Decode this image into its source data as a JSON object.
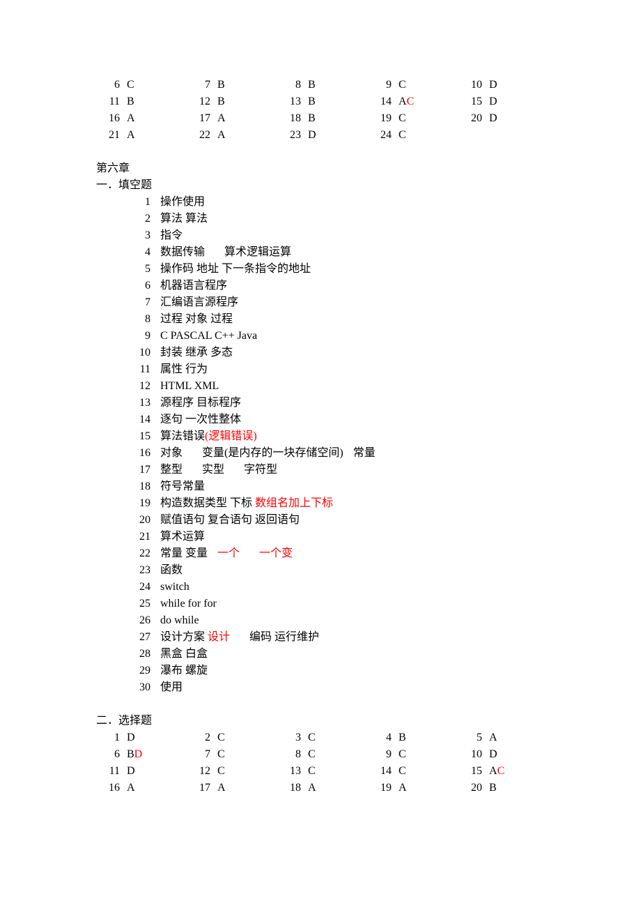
{
  "topMC": [
    [
      {
        "n": "6",
        "a": "C"
      },
      {
        "n": "7",
        "a": "B"
      },
      {
        "n": "8",
        "a": "B"
      },
      {
        "n": "9",
        "a": "C"
      },
      {
        "n": "10",
        "a": "D"
      }
    ],
    [
      {
        "n": "11",
        "a": "B"
      },
      {
        "n": "12",
        "a": "B"
      },
      {
        "n": "13",
        "a": "B"
      },
      {
        "n": "14",
        "a": "A",
        "red": "C"
      },
      {
        "n": "15",
        "a": "D"
      }
    ],
    [
      {
        "n": "16",
        "a": "A"
      },
      {
        "n": "17",
        "a": "A"
      },
      {
        "n": "18",
        "a": "B"
      },
      {
        "n": "19",
        "a": "C"
      },
      {
        "n": "20",
        "a": "D"
      }
    ],
    [
      {
        "n": "21",
        "a": "A"
      },
      {
        "n": "22",
        "a": "A"
      },
      {
        "n": "23",
        "a": "D"
      },
      {
        "n": "24",
        "a": "C"
      }
    ]
  ],
  "chapterTitle": "第六章",
  "section1": "一．填空题",
  "fillBlanks": [
    {
      "n": "1",
      "parts": [
        {
          "t": "操作使用"
        }
      ]
    },
    {
      "n": "2",
      "parts": [
        {
          "t": "算法 算法"
        }
      ]
    },
    {
      "n": "3",
      "parts": [
        {
          "t": "指令"
        }
      ]
    },
    {
      "n": "4",
      "parts": [
        {
          "t": "数据传输"
        },
        {
          "gap": "gap"
        },
        {
          "t": "算术逻辑运算"
        }
      ]
    },
    {
      "n": "5",
      "parts": [
        {
          "t": "操作码 地址 下一条指令的地址"
        }
      ]
    },
    {
      "n": "6",
      "parts": [
        {
          "t": "机器语言程序"
        }
      ]
    },
    {
      "n": "7",
      "parts": [
        {
          "t": "汇编语言源程序"
        }
      ]
    },
    {
      "n": "8",
      "parts": [
        {
          "t": "过程 对象 过程"
        }
      ]
    },
    {
      "n": "9",
      "parts": [
        {
          "t": "C PASCAL C++ Java",
          "mono": true
        }
      ]
    },
    {
      "n": "10",
      "parts": [
        {
          "t": "封装 继承 多态"
        }
      ]
    },
    {
      "n": "11",
      "parts": [
        {
          "t": "属性 行为"
        }
      ]
    },
    {
      "n": "12",
      "parts": [
        {
          "t": "HTML XML",
          "mono": true
        }
      ]
    },
    {
      "n": "13",
      "parts": [
        {
          "t": "源程序 目标程序"
        }
      ]
    },
    {
      "n": "14",
      "parts": [
        {
          "t": "逐句 一次性整体"
        }
      ]
    },
    {
      "n": "15",
      "parts": [
        {
          "t": "算法错误"
        },
        {
          "t": "(逻辑错误)",
          "red": true
        }
      ]
    },
    {
      "n": "16",
      "parts": [
        {
          "t": "对象"
        },
        {
          "gap": "gap"
        },
        {
          "t": "变量(是内存的一块存储空间)"
        },
        {
          "gap": "gap-sm"
        },
        {
          "t": "常量"
        }
      ]
    },
    {
      "n": "17",
      "parts": [
        {
          "t": "整型"
        },
        {
          "gap": "gap"
        },
        {
          "t": "实型"
        },
        {
          "gap": "gap"
        },
        {
          "t": "字符型"
        }
      ]
    },
    {
      "n": "18",
      "parts": [
        {
          "t": "符号常量"
        }
      ]
    },
    {
      "n": "19",
      "parts": [
        {
          "t": "构造数据类型 下标 "
        },
        {
          "t": "数组名加上下标",
          "red": true
        }
      ]
    },
    {
      "n": "20",
      "parts": [
        {
          "t": "赋值语句 复合语句 返回语句"
        }
      ]
    },
    {
      "n": "21",
      "parts": [
        {
          "t": "算术运算"
        }
      ]
    },
    {
      "n": "22",
      "parts": [
        {
          "t": "常量 变量"
        },
        {
          "gap": "gap-sm"
        },
        {
          "t": "一个",
          "red": true
        },
        {
          "gap": "gap"
        },
        {
          "t": "一个变",
          "red": true
        }
      ]
    },
    {
      "n": "23",
      "parts": [
        {
          "t": "函数"
        }
      ]
    },
    {
      "n": "24",
      "parts": [
        {
          "t": "switch",
          "mono": true
        }
      ]
    },
    {
      "n": "25",
      "parts": [
        {
          "t": "while for for",
          "mono": true
        }
      ]
    },
    {
      "n": "26",
      "parts": [
        {
          "t": "do while",
          "mono": true
        }
      ]
    },
    {
      "n": "27",
      "parts": [
        {
          "t": "设计方案 "
        },
        {
          "t": "设计",
          "red": true
        },
        {
          "gap": "gap"
        },
        {
          "t": "编码 运行维护"
        }
      ]
    },
    {
      "n": "28",
      "parts": [
        {
          "t": "黑盒 白盒"
        }
      ]
    },
    {
      "n": "29",
      "parts": [
        {
          "t": "瀑布 螺旋"
        }
      ]
    },
    {
      "n": "30",
      "parts": [
        {
          "t": "使用"
        }
      ]
    }
  ],
  "section2": "二．选择题",
  "bottomMC": [
    [
      {
        "n": "1",
        "a": "D"
      },
      {
        "n": "2",
        "a": "C"
      },
      {
        "n": "3",
        "a": "C"
      },
      {
        "n": "4",
        "a": "B"
      },
      {
        "n": "5",
        "a": "A"
      }
    ],
    [
      {
        "n": "6",
        "a": "B",
        "red": "D"
      },
      {
        "n": "7",
        "a": "C"
      },
      {
        "n": "8",
        "a": "C"
      },
      {
        "n": "9",
        "a": "C"
      },
      {
        "n": "10",
        "a": "D"
      }
    ],
    [
      {
        "n": "11",
        "a": "D"
      },
      {
        "n": "12",
        "a": "C"
      },
      {
        "n": "13",
        "a": "C"
      },
      {
        "n": "14",
        "a": "C"
      },
      {
        "n": "15",
        "a": "A",
        "red": "C"
      }
    ],
    [
      {
        "n": "16",
        "a": "A"
      },
      {
        "n": "17",
        "a": "A"
      },
      {
        "n": "18",
        "a": "A"
      },
      {
        "n": "19",
        "a": "A"
      },
      {
        "n": "20",
        "a": "B"
      }
    ]
  ]
}
